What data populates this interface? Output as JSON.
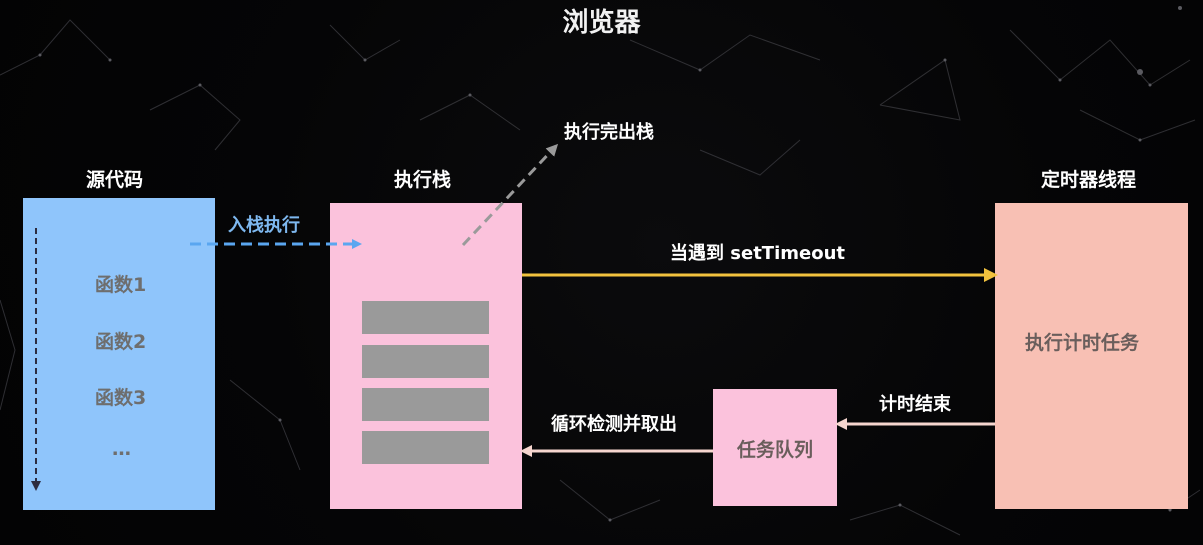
{
  "title": "浏览器",
  "source_code": {
    "heading": "源代码",
    "functions": [
      "函数1",
      "函数2",
      "函数3",
      "…"
    ]
  },
  "execution_stack": {
    "heading": "执行栈",
    "slot_count": 4
  },
  "timer_thread": {
    "heading": "定时器线程",
    "body": "执行计时任务"
  },
  "task_queue": {
    "body": "任务队列"
  },
  "arrows": {
    "push": "入栈执行",
    "pop": "执行完出栈",
    "set_timeout": "当遇到 setTimeout",
    "timer_done": "计时结束",
    "loop": "循环检测并取出"
  },
  "colors": {
    "background": "#050506",
    "source_box": "#8fc5fb",
    "stack_box": "#fbc2dc",
    "timer_box": "#f8c0b4",
    "queue_box": "#fbc2dc",
    "stack_slot": "#9a9a9a",
    "push_arrow": "#5aa6f0",
    "pop_arrow": "#9a9a9a",
    "settimeout_arrow": "#f2c23e",
    "return_arrow": "#f6d6cf"
  }
}
